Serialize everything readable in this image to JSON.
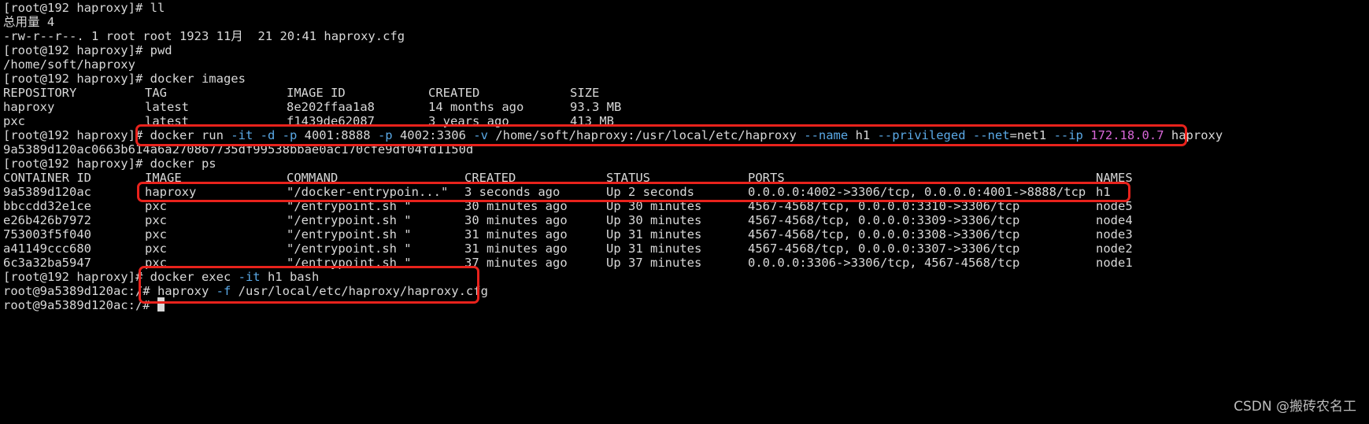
{
  "lines": {
    "l0": "[root@192 haproxy]# ll",
    "l1": "总用量 4",
    "l2": "-rw-r--r--. 1 root root 1923 11月  21 20:41 haproxy.cfg",
    "l3": "[root@192 haproxy]# pwd",
    "l4": "/home/soft/haproxy",
    "l5": "[root@192 haproxy]# docker images"
  },
  "images_table": {
    "headers": [
      "REPOSITORY",
      "TAG",
      "IMAGE ID",
      "CREATED",
      "SIZE"
    ],
    "rows": [
      [
        "haproxy",
        "latest",
        "8e202ffaa1a8",
        "14 months ago",
        "93.3 MB"
      ],
      [
        "pxc",
        "latest",
        "f1439de62087",
        "3 years ago",
        "413 MB"
      ]
    ]
  },
  "run_cmd": {
    "prompt": "[root@192 haproxy]# ",
    "p1": "docker run ",
    "f1": "-it -d -p",
    "p2": " 4001:8888 ",
    "f2": "-p",
    "p3": " 4002:3306 ",
    "f3": "-v",
    "p4": " /home/soft/haproxy:/usr/local/etc/haproxy ",
    "f4": "--name",
    "p5": " h1 ",
    "f5": "--privileged",
    "p6": " ",
    "f6": "--net",
    "p7": "=net1 ",
    "f7": "--ip",
    "p8": " ",
    "ip": "172.18.0.7",
    "p9": " haproxy"
  },
  "container_hash": "9a5389d120ac0663b614a6a270867735df99538bbae0ac170cfe9df04fd1150d",
  "ps_cmd": "[root@192 haproxy]# docker ps",
  "ps_table": {
    "headers": [
      "CONTAINER ID",
      "IMAGE",
      "COMMAND",
      "CREATED",
      "STATUS",
      "PORTS",
      "NAMES"
    ],
    "rows": [
      [
        "9a5389d120ac",
        "haproxy",
        "\"/docker-entrypoin...\"",
        "3 seconds ago",
        "Up 2 seconds",
        "0.0.0.0:4002->3306/tcp, 0.0.0.0:4001->8888/tcp",
        "h1"
      ],
      [
        "bbccdd32e1ce",
        "pxc",
        "\"/entrypoint.sh \"",
        "30 minutes ago",
        "Up 30 minutes",
        "4567-4568/tcp, 0.0.0.0:3310->3306/tcp",
        "node5"
      ],
      [
        "e26b426b7972",
        "pxc",
        "\"/entrypoint.sh \"",
        "30 minutes ago",
        "Up 30 minutes",
        "4567-4568/tcp, 0.0.0.0:3309->3306/tcp",
        "node4"
      ],
      [
        "753003f5f040",
        "pxc",
        "\"/entrypoint.sh \"",
        "31 minutes ago",
        "Up 31 minutes",
        "4567-4568/tcp, 0.0.0.0:3308->3306/tcp",
        "node3"
      ],
      [
        "a41149ccc680",
        "pxc",
        "\"/entrypoint.sh \"",
        "31 minutes ago",
        "Up 31 minutes",
        "4567-4568/tcp, 0.0.0.0:3307->3306/tcp",
        "node2"
      ],
      [
        "6c3a32ba5947",
        "pxc",
        "\"/entrypoint.sh \"",
        "37 minutes ago",
        "Up 37 minutes",
        "0.0.0.0:3306->3306/tcp, 4567-4568/tcp",
        "node1"
      ]
    ]
  },
  "exec_cmd": {
    "prompt": "[root@192 haproxy]# ",
    "p1": "docker exec ",
    "f1": "-it",
    "p2": " h1 bash"
  },
  "haproxy_cmd": {
    "prompt": "root@9a5389d120ac:/# ",
    "p1": "haproxy ",
    "f1": "-f",
    "p2": " /usr/local/etc/haproxy/haproxy.cfg"
  },
  "final_prompt": "root@9a5389d120ac:/# ",
  "watermark": "CSDN @搬砖农名工",
  "colors": {
    "background": "#000000",
    "text": "#d8d8d8",
    "flag": "#5aa9e6",
    "ip": "#d766d7",
    "highlight_box": "#e8221c"
  }
}
